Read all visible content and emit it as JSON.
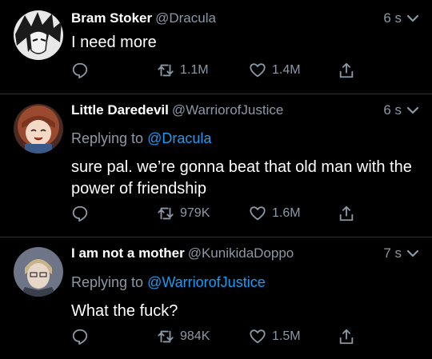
{
  "tweets": [
    {
      "name": "Bram Stoker",
      "handle": "@Dracula",
      "time": "6 s",
      "replying_label": "",
      "replying_to": "",
      "text": "I need more",
      "retweets": "1.1M",
      "likes": "1.4M"
    },
    {
      "name": "Little Daredevil",
      "handle": "@WarriorofJustice",
      "time": "6 s",
      "replying_label": "Replying to",
      "replying_to": "@Dracula",
      "text": "sure pal. we’re gonna beat that old man with the power of friendship",
      "retweets": "979K",
      "likes": "1.6M"
    },
    {
      "name": "I am not a mother",
      "handle": "@KunikidaDoppo",
      "time": "7 s",
      "replying_label": "Replying to",
      "replying_to": "@WarriorofJustice",
      "text": "What the fuck?",
      "retweets": "984K",
      "likes": "1.5M"
    }
  ],
  "icons": {
    "reply": "speech-bubble-icon",
    "retweet": "retweet-icon",
    "like": "heart-icon",
    "share": "share-icon",
    "menu": "chevron-down-icon"
  },
  "colors": {
    "background": "#000000",
    "text": "#ffffff",
    "muted": "#8b98a5",
    "mention": "#1d9bf0",
    "divider": "#2f3336"
  }
}
